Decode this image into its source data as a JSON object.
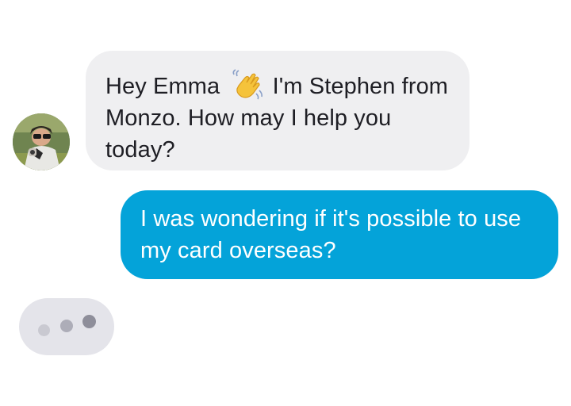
{
  "conversation": {
    "agent": {
      "avatar_icon": "agent-avatar-photo"
    },
    "messages": [
      {
        "sender": "agent",
        "text_before_emoji": "Hey Emma",
        "emoji_icon": "waving-hand-icon",
        "text_after_emoji": "I'm Stephen from Monzo. How may I help you today?"
      },
      {
        "sender": "user",
        "text": "I was wondering if it's possible to use my card overseas?"
      }
    ],
    "typing_indicator": {
      "icon": "typing-dots-icon"
    }
  },
  "colors": {
    "incoming_bubble": "#efeff1",
    "outgoing_bubble": "#04a3d9",
    "incoming_text": "#1e1e24",
    "outgoing_text": "#ffffff",
    "typing_bubble": "#e4e4ea"
  }
}
